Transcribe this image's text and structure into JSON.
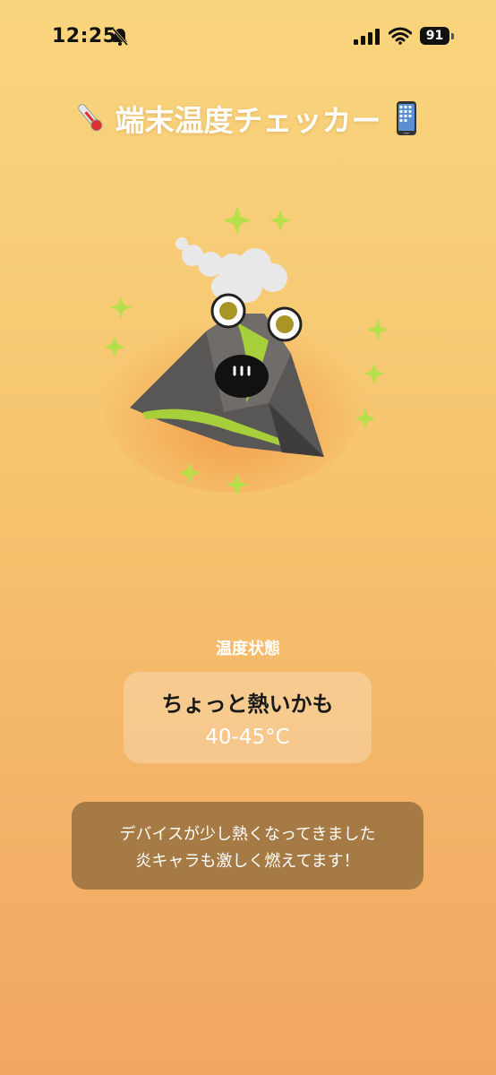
{
  "status_bar": {
    "time": "12:25",
    "battery": "91",
    "icons": [
      "bell-slash-icon",
      "cellular-signal-icon",
      "wifi-icon",
      "battery-icon"
    ]
  },
  "header": {
    "title": "端末温度チェッカー",
    "left_icon": "thermometer-icon",
    "right_icon": "mobile-phone-icon"
  },
  "mascot": {
    "name": "volcano-character"
  },
  "temperature": {
    "label": "温度状態",
    "status": "ちょっと熱いかも",
    "range": "40-45°C"
  },
  "message": {
    "line1": "デバイスが少し熱くなってきました",
    "line2": "炎キャラも激しく燃えてます！"
  },
  "colors": {
    "bg_top": "#f9d57e",
    "bg_bottom": "#f2a862",
    "message_bg": "#a67a45",
    "text": "#ffffff"
  }
}
